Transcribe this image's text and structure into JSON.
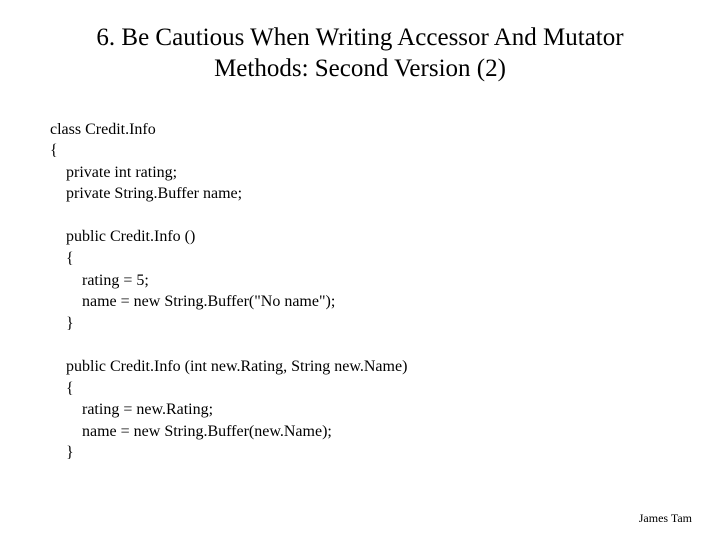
{
  "title_line1": "6. Be Cautious When Writing Accessor And Mutator",
  "title_line2": "Methods: Second Version (2)",
  "code": "class Credit.Info\n{\n    private int rating;\n    private String.Buffer name;\n\n    public Credit.Info ()\n    {\n        rating = 5;\n        name = new String.Buffer(\"No name\");\n    }\n\n    public Credit.Info (int new.Rating, String new.Name)\n    {\n        rating = new.Rating;\n        name = new String.Buffer(new.Name);\n    }",
  "footer": "James Tam"
}
